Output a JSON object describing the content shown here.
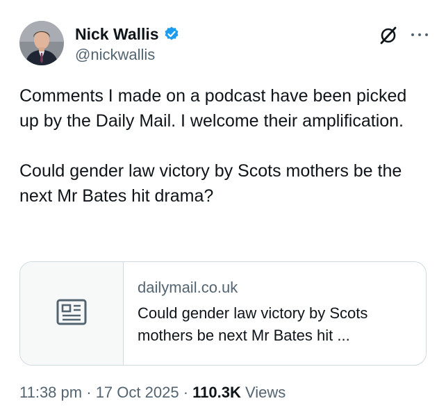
{
  "author": {
    "display_name": "Nick Wallis",
    "handle": "@nickwallis",
    "verified": true,
    "verified_color": "#1d9bf0"
  },
  "header_icons": [
    "grok-icon",
    "more-icon"
  ],
  "tweet": {
    "paragraph_1": "Comments I made on a podcast have been picked up by the Daily Mail. I welcome their amplification.",
    "paragraph_2": "Could gender law victory by Scots mothers be the next Mr Bates hit drama?"
  },
  "link_card": {
    "icon": "article-icon",
    "domain": "dailymail.co.uk",
    "title": "Could gender law victory by Scots mothers be next Mr Bates hit ..."
  },
  "meta": {
    "time": "11:38 pm",
    "separator": "·",
    "date": "17 Oct 2025",
    "views_count": "110.3K",
    "views_label": "Views"
  }
}
